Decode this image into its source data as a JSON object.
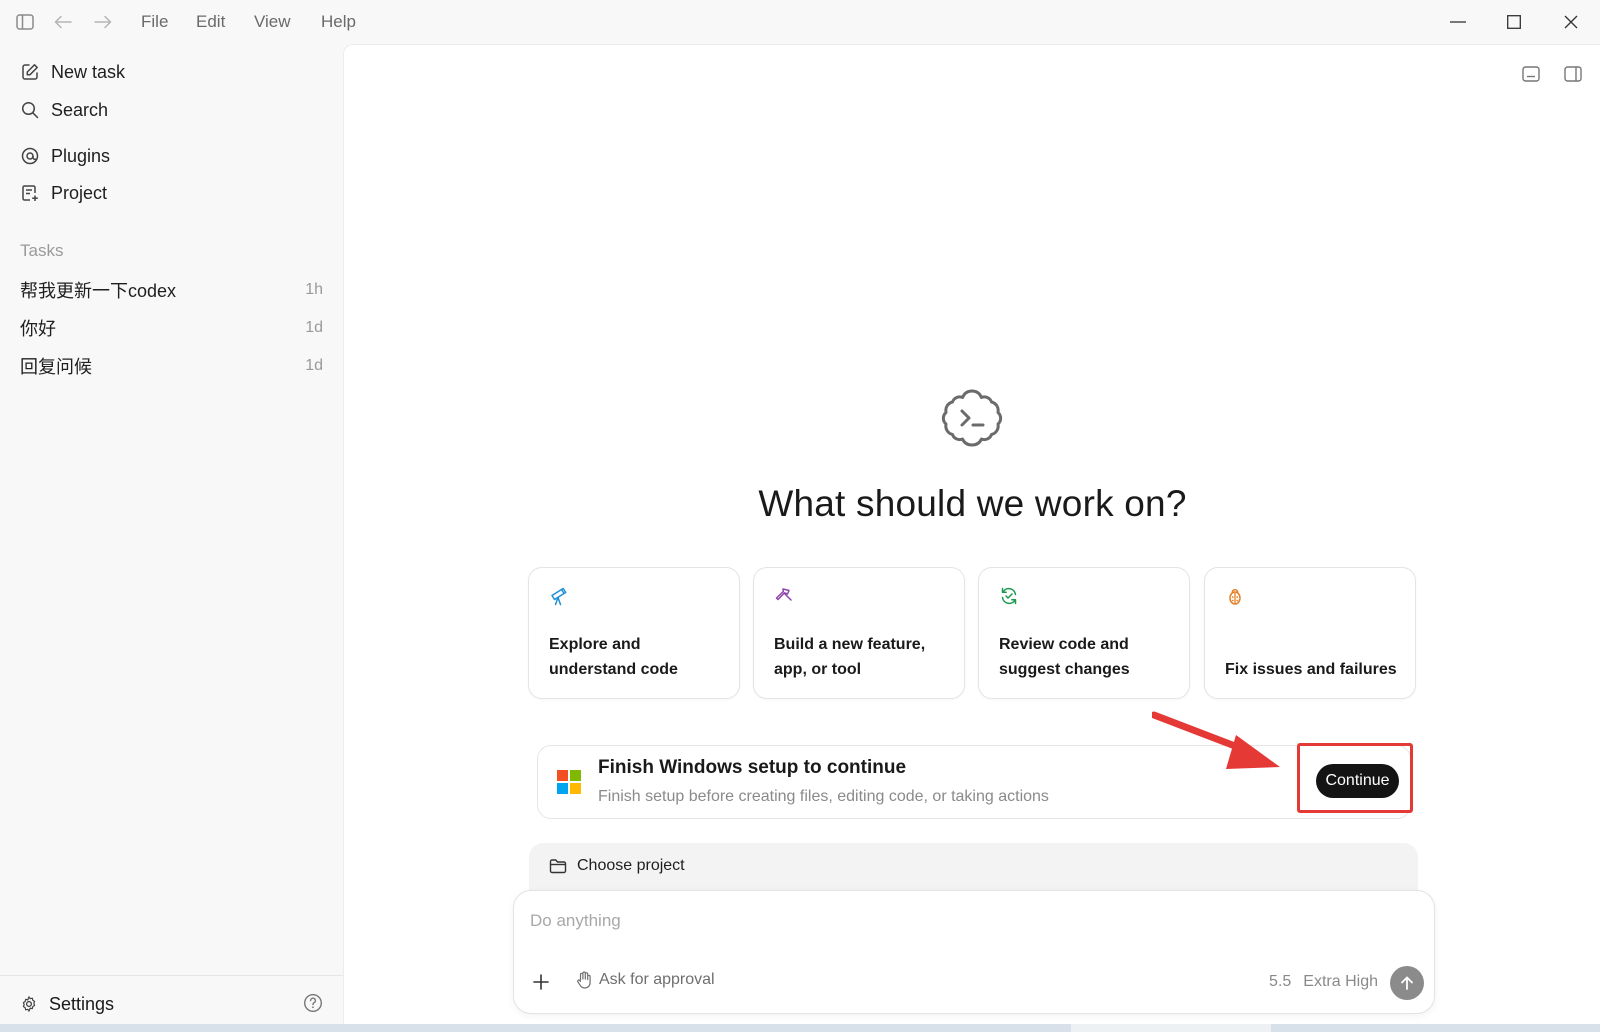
{
  "menu": {
    "file": "File",
    "edit": "Edit",
    "view": "View",
    "help": "Help"
  },
  "sidebar": {
    "new_task": "New task",
    "search": "Search",
    "plugins": "Plugins",
    "project": "Project",
    "tasks_label": "Tasks",
    "tasks": [
      {
        "title": "帮我更新一下codex",
        "age": "1h"
      },
      {
        "title": "你好",
        "age": "1d"
      },
      {
        "title": "回复问候",
        "age": "1d"
      }
    ],
    "settings": "Settings"
  },
  "main": {
    "title": "What should we work on?",
    "cards": [
      {
        "label": "Explore and understand code",
        "icon": "telescope-icon",
        "color": "#1f8fd6"
      },
      {
        "label": "Build a new feature, app, or tool",
        "icon": "hammer-icon",
        "color": "#8e44ad"
      },
      {
        "label": "Review code and suggest changes",
        "icon": "refresh-check-icon",
        "color": "#1a9a4a"
      },
      {
        "label": "Fix issues and failures",
        "icon": "bug-icon",
        "color": "#e67e22"
      }
    ],
    "setup": {
      "title": "Finish Windows setup to continue",
      "subtitle": "Finish setup before creating files, editing code, or taking actions",
      "button": "Continue"
    },
    "project_bar": "Choose project",
    "composer": {
      "placeholder": "Do anything",
      "approval": "Ask for approval",
      "model_version": "5.5",
      "reasoning": "Extra High"
    }
  },
  "colors": {
    "accent_red": "#e53935",
    "button_dark": "#141414",
    "ms_red": "#f25022",
    "ms_green": "#7fba00",
    "ms_blue": "#00a4ef",
    "ms_yellow": "#ffb900"
  }
}
